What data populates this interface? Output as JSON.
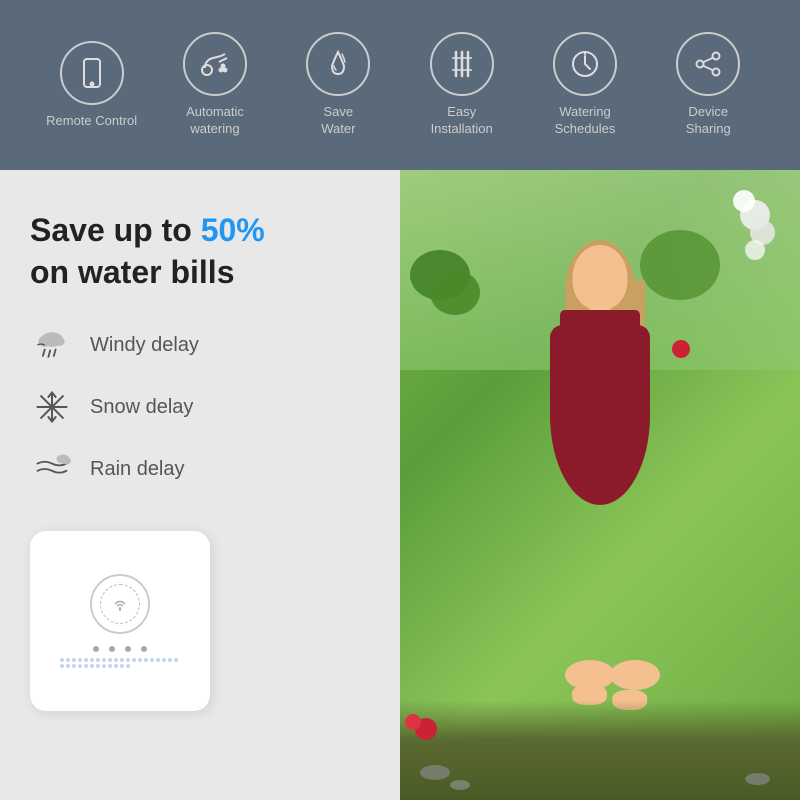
{
  "topBar": {
    "bgColor": "#5a6a7a",
    "features": [
      {
        "id": "remote-control",
        "label": "Remote\nControl",
        "icon": "phone"
      },
      {
        "id": "automatic-watering",
        "label": "Automatic\nwatering",
        "icon": "watering-can"
      },
      {
        "id": "save-water",
        "label": "Save\nWater",
        "icon": "water-drop"
      },
      {
        "id": "easy-installation",
        "label": "Easy\nInstallation",
        "icon": "tools"
      },
      {
        "id": "watering-schedules",
        "label": "Watering\nSchedules",
        "icon": "clock"
      },
      {
        "id": "device-sharing",
        "label": "Device\nSharing",
        "icon": "share"
      }
    ]
  },
  "leftPanel": {
    "headline1": "Save up to ",
    "headlinePercent": "50%",
    "headline2": "on water bills",
    "weatherItems": [
      {
        "id": "windy-delay",
        "label": "Windy delay",
        "icon": "wind-rain"
      },
      {
        "id": "snow-delay",
        "label": "Snow delay",
        "icon": "snowflake"
      },
      {
        "id": "rain-delay",
        "label": "Rain delay",
        "icon": "wind"
      }
    ]
  },
  "accentColor": "#2196f3"
}
